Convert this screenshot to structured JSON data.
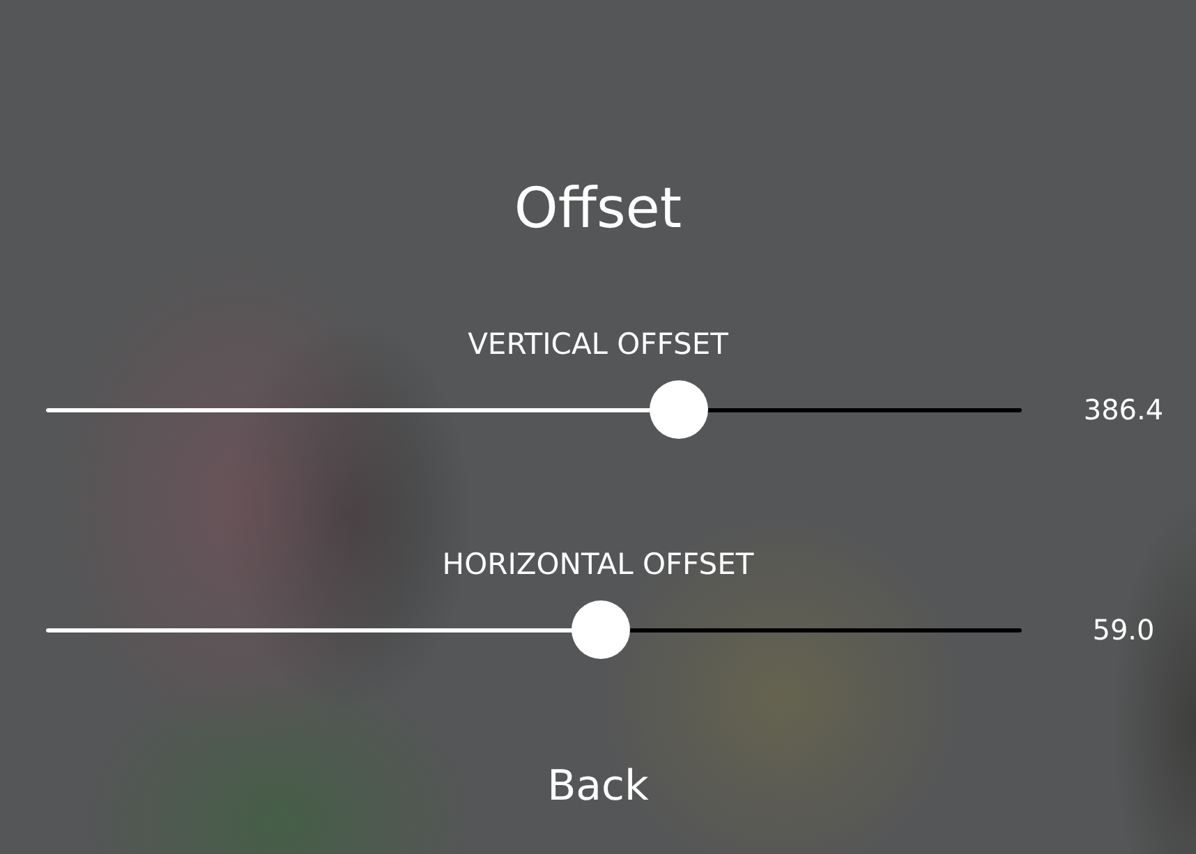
{
  "title": "Offset",
  "sliders": [
    {
      "label": "VERTICAL OFFSET",
      "level": 0.649,
      "reading": "386.4"
    },
    {
      "label": "HORIZONTAL OFFSET",
      "level": 0.569,
      "reading": "59.0"
    }
  ],
  "back_button": "Back"
}
